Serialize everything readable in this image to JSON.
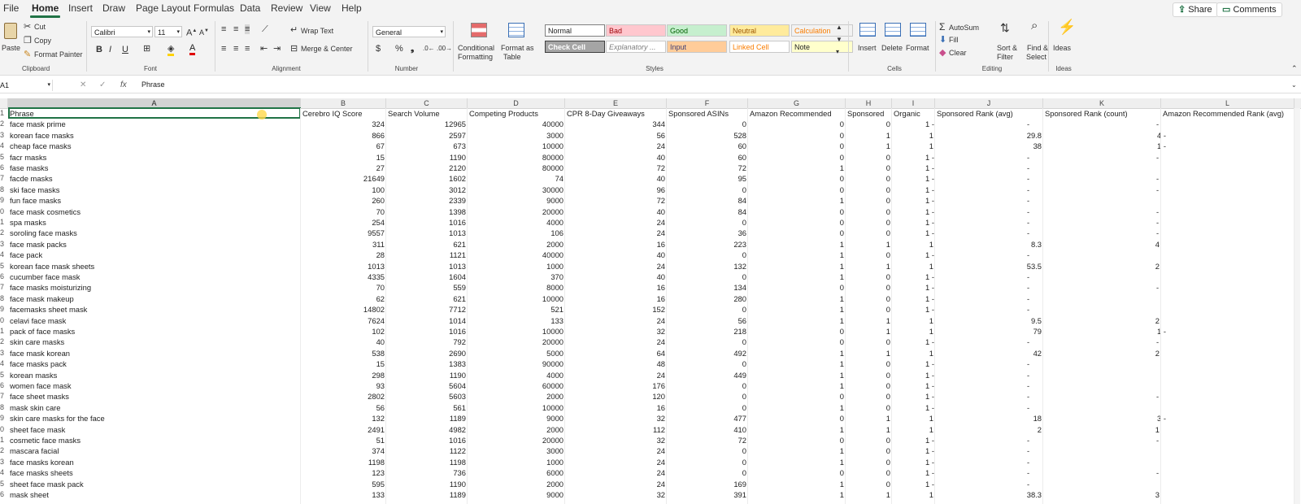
{
  "menu": {
    "tabs": [
      "File",
      "Home",
      "Insert",
      "Draw",
      "Page Layout",
      "Formulas",
      "Data",
      "Review",
      "View",
      "Help"
    ],
    "share": "Share",
    "comments": "Comments"
  },
  "ribbon": {
    "clipboard": {
      "paste": "Paste",
      "cut": "Cut",
      "copy": "Copy",
      "format_painter": "Format Painter",
      "label": "Clipboard"
    },
    "font": {
      "family": "Calibri",
      "size": "11",
      "label": "Font"
    },
    "alignment": {
      "wrap": "Wrap Text",
      "merge": "Merge & Center",
      "label": "Alignment"
    },
    "number": {
      "format": "General",
      "label": "Number"
    },
    "styles": {
      "conditional": "Conditional",
      "formatting": "Formatting",
      "format_as": "Format as",
      "table": "Table",
      "cells": [
        {
          "text": "Normal",
          "bg": "#ffffff",
          "fg": "#222222"
        },
        {
          "text": "Bad",
          "bg": "#ffc7ce",
          "fg": "#9c0006"
        },
        {
          "text": "Good",
          "bg": "#c6efce",
          "fg": "#006100"
        },
        {
          "text": "Neutral",
          "bg": "#ffeb9c",
          "fg": "#9c5700"
        },
        {
          "text": "Calculation",
          "bg": "#f2f2f2",
          "fg": "#fa7d00"
        },
        {
          "text": "Check Cell",
          "bg": "#a5a5a5",
          "fg": "#ffffff"
        },
        {
          "text": "Explanatory ...",
          "bg": "#ffffff",
          "fg": "#7f7f7f"
        },
        {
          "text": "Input",
          "bg": "#ffcc99",
          "fg": "#3f3f76"
        },
        {
          "text": "Linked Cell",
          "bg": "#ffffff",
          "fg": "#fa7d00"
        },
        {
          "text": "Note",
          "bg": "#ffffcc",
          "fg": "#222222"
        }
      ],
      "label": "Styles"
    },
    "cells": {
      "insert": "Insert",
      "delete": "Delete",
      "format": "Format",
      "label": "Cells"
    },
    "editing": {
      "autosum": "AutoSum",
      "fill": "Fill",
      "clear": "Clear",
      "sort1": "Sort &",
      "sort2": "Filter",
      "find1": "Find &",
      "find2": "Select",
      "label": "Editing"
    },
    "ideas": {
      "button": "Ideas",
      "label": "Ideas"
    }
  },
  "formula_bar": {
    "name_box": "A1",
    "fx": "fx",
    "content": "Phrase"
  },
  "grid": {
    "columns": [
      "A",
      "B",
      "C",
      "D",
      "E",
      "F",
      "G",
      "H",
      "I",
      "J",
      "K",
      "L"
    ],
    "header": [
      "Phrase",
      "Cerebro IQ Score",
      "Search Volume",
      "Competing Products",
      "CPR 8-Day Giveaways",
      "Sponsored ASINs",
      "Amazon Recommended",
      "Sponsored",
      "Organic",
      "Sponsored Rank (avg)",
      "Sponsored Rank (count)",
      "Amazon Recommended Rank (avg)"
    ],
    "row_numbers": [
      "1",
      "2",
      "3",
      "4",
      "5",
      "6",
      "7",
      "8",
      "9",
      "0",
      "1",
      "2",
      "3",
      "4",
      "5",
      "6",
      "7",
      "8",
      "9",
      "0",
      "1",
      "2",
      "3",
      "4",
      "5",
      "6",
      "7",
      "8",
      "9",
      "0",
      "1",
      "2",
      "3",
      "4",
      "5",
      "6"
    ],
    "rows": [
      [
        "face mask prime",
        "324",
        "12965",
        "40000",
        "344",
        "0",
        "0",
        "0",
        "1 -",
        "-",
        "-"
      ],
      [
        "korean face masks",
        "866",
        "2597",
        "3000",
        "56",
        "528",
        "0",
        "1",
        "1",
        "29.8",
        "4 -"
      ],
      [
        "cheap face masks",
        "67",
        "673",
        "10000",
        "24",
        "60",
        "0",
        "1",
        "1",
        "38",
        "1 -"
      ],
      [
        "facr masks",
        "15",
        "1190",
        "80000",
        "40",
        "60",
        "0",
        "0",
        "1 -",
        "-",
        "-"
      ],
      [
        "fase masks",
        "27",
        "2120",
        "80000",
        "72",
        "72",
        "1",
        "0",
        "1 -",
        "-",
        ""
      ],
      [
        "facde masks",
        "21649",
        "1602",
        "74",
        "40",
        "95",
        "0",
        "0",
        "1 -",
        "-",
        "-"
      ],
      [
        "ski face masks",
        "100",
        "3012",
        "30000",
        "96",
        "0",
        "0",
        "0",
        "1 -",
        "-",
        "-"
      ],
      [
        "fun face masks",
        "260",
        "2339",
        "9000",
        "72",
        "84",
        "1",
        "0",
        "1 -",
        "-",
        ""
      ],
      [
        "face mask cosmetics",
        "70",
        "1398",
        "20000",
        "40",
        "84",
        "0",
        "0",
        "1 -",
        "-",
        "-"
      ],
      [
        "spa masks",
        "254",
        "1016",
        "4000",
        "24",
        "0",
        "0",
        "0",
        "1 -",
        "-",
        "-"
      ],
      [
        "soroling face masks",
        "9557",
        "1013",
        "106",
        "24",
        "36",
        "0",
        "0",
        "1 -",
        "-",
        "-"
      ],
      [
        "face mask packs",
        "311",
        "621",
        "2000",
        "16",
        "223",
        "1",
        "1",
        "1",
        "8.3",
        "4"
      ],
      [
        "face pack",
        "28",
        "1121",
        "40000",
        "40",
        "0",
        "1",
        "0",
        "1 -",
        "-",
        ""
      ],
      [
        "korean face mask sheets",
        "1013",
        "1013",
        "1000",
        "24",
        "132",
        "1",
        "1",
        "1",
        "53.5",
        "2"
      ],
      [
        "cucumber face mask",
        "4335",
        "1604",
        "370",
        "40",
        "0",
        "1",
        "0",
        "1 -",
        "-",
        ""
      ],
      [
        "face masks moisturizing",
        "70",
        "559",
        "8000",
        "16",
        "134",
        "0",
        "0",
        "1 -",
        "-",
        "-"
      ],
      [
        "face mask makeup",
        "62",
        "621",
        "10000",
        "16",
        "280",
        "1",
        "0",
        "1 -",
        "-",
        ""
      ],
      [
        "facemasks sheet mask",
        "14802",
        "7712",
        "521",
        "152",
        "0",
        "1",
        "0",
        "1 -",
        "-",
        ""
      ],
      [
        "celavi face mask",
        "7624",
        "1014",
        "133",
        "24",
        "56",
        "1",
        "1",
        "1",
        "9.5",
        "2"
      ],
      [
        "pack of face masks",
        "102",
        "1016",
        "10000",
        "32",
        "218",
        "0",
        "1",
        "1",
        "79",
        "1 -"
      ],
      [
        "skin care masks",
        "40",
        "792",
        "20000",
        "24",
        "0",
        "0",
        "0",
        "1 -",
        "-",
        "-"
      ],
      [
        "face mask korean",
        "538",
        "2690",
        "5000",
        "64",
        "492",
        "1",
        "1",
        "1",
        "42",
        "2"
      ],
      [
        "face masks pack",
        "15",
        "1383",
        "90000",
        "48",
        "0",
        "1",
        "0",
        "1 -",
        "-",
        ""
      ],
      [
        "korean masks",
        "298",
        "1190",
        "4000",
        "24",
        "449",
        "1",
        "0",
        "1 -",
        "-",
        ""
      ],
      [
        "women face mask",
        "93",
        "5604",
        "60000",
        "176",
        "0",
        "1",
        "0",
        "1 -",
        "-",
        ""
      ],
      [
        "face sheet masks",
        "2802",
        "5603",
        "2000",
        "120",
        "0",
        "0",
        "0",
        "1 -",
        "-",
        "-"
      ],
      [
        "mask skin care",
        "56",
        "561",
        "10000",
        "16",
        "0",
        "1",
        "0",
        "1 -",
        "-",
        ""
      ],
      [
        "skin care masks for the face",
        "132",
        "1189",
        "9000",
        "32",
        "477",
        "0",
        "1",
        "1",
        "18",
        "3 -"
      ],
      [
        "sheet face mask",
        "2491",
        "4982",
        "2000",
        "112",
        "410",
        "1",
        "1",
        "1",
        "2",
        "1"
      ],
      [
        "cosmetic face masks",
        "51",
        "1016",
        "20000",
        "32",
        "72",
        "0",
        "0",
        "1 -",
        "-",
        "-"
      ],
      [
        "mascara facial",
        "374",
        "1122",
        "3000",
        "24",
        "0",
        "1",
        "0",
        "1 -",
        "-",
        ""
      ],
      [
        "face masks korean",
        "1198",
        "1198",
        "1000",
        "24",
        "0",
        "1",
        "0",
        "1 -",
        "-",
        ""
      ],
      [
        "face masks sheets",
        "123",
        "736",
        "6000",
        "24",
        "0",
        "0",
        "0",
        "1 -",
        "-",
        "-"
      ],
      [
        "sheet face mask pack",
        "595",
        "1190",
        "2000",
        "24",
        "169",
        "1",
        "0",
        "1 -",
        "-",
        ""
      ],
      [
        "mask sheet",
        "133",
        "1189",
        "9000",
        "32",
        "391",
        "1",
        "1",
        "1",
        "38.3",
        "3"
      ]
    ]
  }
}
